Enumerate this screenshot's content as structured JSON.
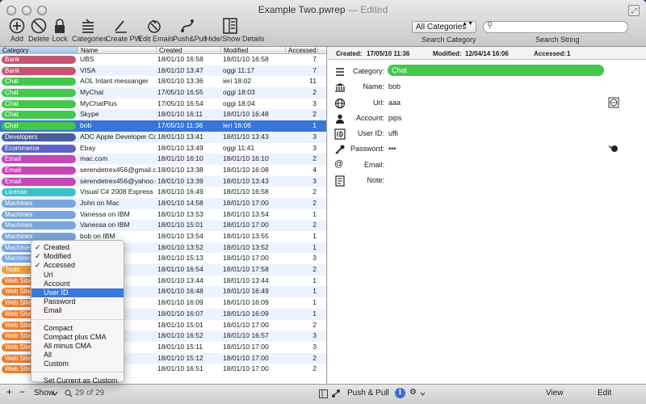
{
  "window": {
    "title": "Example Two.pwrep",
    "status": "— Edited",
    "fullscreen_glyph": "⤢"
  },
  "toolbar": {
    "items": [
      {
        "label": "Add",
        "icon": "add-icon"
      },
      {
        "label": "Delete",
        "icon": "delete-icon"
      },
      {
        "label": "Lock",
        "icon": "lock-icon"
      },
      {
        "label": "Categories",
        "icon": "categories-icon"
      },
      {
        "label": "Create PW",
        "icon": "create-pw-icon"
      },
      {
        "label": "Edit Emails",
        "icon": "edit-emails-icon"
      },
      {
        "label": "Push&Pull",
        "icon": "push-pull-icon"
      },
      {
        "label": "Hide/Show Details",
        "icon": "details-icon"
      }
    ],
    "category_select": "All Categories",
    "category_arrows": "▲▼",
    "search_category_label": "Search Category",
    "search_string_label": "Search String",
    "search_glyph": "⚲"
  },
  "table": {
    "headers": [
      "Category",
      "Name",
      "Created",
      "Modified",
      "Accessed"
    ],
    "rows": [
      {
        "cat": "Bank",
        "color": "#c4566f",
        "name": "UBS",
        "created": "18/01/10 16:58",
        "modified": "18/01/10 16:58",
        "accessed": "7"
      },
      {
        "cat": "Bank",
        "color": "#c4566f",
        "name": "VISA",
        "created": "18/01/10 13:47",
        "modified": "oggi 11:17",
        "accessed": "7"
      },
      {
        "cat": "Chat",
        "color": "#43c84c",
        "name": "AOL Intant messanger",
        "created": "18/01/10 13:36",
        "modified": "ieri 18:02",
        "accessed": "11"
      },
      {
        "cat": "Chat",
        "color": "#43c84c",
        "name": "MyChat",
        "created": "17/05/10 16:55",
        "modified": "oggi 18:03",
        "accessed": "2"
      },
      {
        "cat": "Chat",
        "color": "#43c84c",
        "name": "MyChatPlus",
        "created": "17/05/10 16:54",
        "modified": "oggi 18:04",
        "accessed": "3"
      },
      {
        "cat": "Chat",
        "color": "#43c84c",
        "name": "Skype",
        "created": "18/01/10 16:11",
        "modified": "18/01/10 16:48",
        "accessed": "2"
      },
      {
        "cat": "Chat",
        "color": "#43c84c",
        "name": "bob",
        "created": "17/05/10 11:36",
        "modified": "ieri 16:06",
        "accessed": "1",
        "selected": true
      },
      {
        "cat": "Developers",
        "color": "#4a5f9a",
        "name": "ADC Apple Developer Cor",
        "created": "18/01/10 13:41",
        "modified": "18/01/10 13:43",
        "accessed": "3"
      },
      {
        "cat": "Ecommerce",
        "color": "#5b63c7",
        "name": "Ebay",
        "created": "18/01/10 13:49",
        "modified": "oggi 11:41",
        "accessed": "3"
      },
      {
        "cat": "Email",
        "color": "#c547b8",
        "name": "mac.com",
        "created": "18/01/10 16:10",
        "modified": "18/01/10 16:10",
        "accessed": "2"
      },
      {
        "cat": "Email",
        "color": "#c547b8",
        "name": "serendetrex456@gmail.co",
        "created": "18/01/10 13:38",
        "modified": "18/01/10 16:08",
        "accessed": "4"
      },
      {
        "cat": "Email",
        "color": "#c547b8",
        "name": "serendetrex456@yahoo.c",
        "created": "18/01/10 13:39",
        "modified": "18/01/10 13:43",
        "accessed": "3"
      },
      {
        "cat": "License",
        "color": "#3bbfc9",
        "name": "Visual C# 2008 Express",
        "created": "18/01/10 16:49",
        "modified": "18/01/10 16:58",
        "accessed": "2"
      },
      {
        "cat": "Machines",
        "color": "#7aa6dc",
        "name": "John on Mac",
        "created": "18/01/10 14:58",
        "modified": "18/01/10 17:00",
        "accessed": "2"
      },
      {
        "cat": "Machines",
        "color": "#7aa6dc",
        "name": "Vanessa on IBM",
        "created": "18/01/10 13:53",
        "modified": "18/01/10 13:54",
        "accessed": "1"
      },
      {
        "cat": "Machines",
        "color": "#7aa6dc",
        "name": "Vanessa on IBM",
        "created": "18/01/10 15:01",
        "modified": "18/01/10 17:00",
        "accessed": "2"
      },
      {
        "cat": "Machines",
        "color": "#7aa6dc",
        "name": "bob on IBM",
        "created": "18/01/10 13:54",
        "modified": "18/01/10 13:55",
        "accessed": "1"
      },
      {
        "cat": "Machines",
        "color": "#7aa6dc",
        "name": "",
        "created": "18/01/10 13:52",
        "modified": "18/01/10 13:52",
        "accessed": "1"
      },
      {
        "cat": "Machines",
        "color": "#7aa6dc",
        "name": "",
        "created": "18/01/10 15:13",
        "modified": "18/01/10 17:00",
        "accessed": "3"
      },
      {
        "cat": "Tools",
        "color": "#e6a23c",
        "name": "",
        "created": "18/01/10 16:54",
        "modified": "18/01/10 17:58",
        "accessed": "2"
      },
      {
        "cat": "Web Sites",
        "color": "#ec7d2c",
        "name": "",
        "created": "18/01/10 13:44",
        "modified": "18/01/10 13:44",
        "accessed": "1"
      },
      {
        "cat": "Web Sites",
        "color": "#ec7d2c",
        "name": "",
        "created": "18/01/10 16:48",
        "modified": "18/01/10 16:49",
        "accessed": "1"
      },
      {
        "cat": "Web Sites",
        "color": "#ec7d2c",
        "name": "",
        "created": "18/01/10 16:09",
        "modified": "18/01/10 16:09",
        "accessed": "1"
      },
      {
        "cat": "Web Sites",
        "color": "#ec7d2c",
        "name": "",
        "created": "18/01/10 16:07",
        "modified": "18/01/10 16:09",
        "accessed": "1"
      },
      {
        "cat": "Web Sites",
        "color": "#ec7d2c",
        "name": "",
        "created": "18/01/10 15:01",
        "modified": "18/01/10 17:00",
        "accessed": "2"
      },
      {
        "cat": "Web Sites",
        "color": "#ec7d2c",
        "name": "",
        "created": "18/01/10 16:52",
        "modified": "18/01/10 16:57",
        "accessed": "3"
      },
      {
        "cat": "Web Sites",
        "color": "#ec7d2c",
        "name": "",
        "created": "18/01/10 15:11",
        "modified": "18/01/10 17:00",
        "accessed": "3"
      },
      {
        "cat": "Web Sites",
        "color": "#ec7d2c",
        "name": "",
        "created": "18/01/10 15:12",
        "modified": "18/01/10 17:00",
        "accessed": "2"
      },
      {
        "cat": "Web Sites",
        "color": "#ec7d2c",
        "name": "",
        "created": "18/01/10 16:51",
        "modified": "18/01/10 17:00",
        "accessed": "2"
      }
    ]
  },
  "bottombar": {
    "add": "+",
    "remove": "−",
    "show": "Show",
    "count": "29 of 29",
    "pushpull": "Push & Pull",
    "info": "i",
    "gear": "⚙",
    "view": "View",
    "edit": "Edit"
  },
  "detail": {
    "created_label": "Created:",
    "created": "17/05/10 11:36",
    "modified_label": "Modified:",
    "modified": "12/04/14 16:06",
    "accessed_label": "Accessed:",
    "accessed": "1",
    "fields": [
      {
        "label": "Category:",
        "value": "Chat",
        "icon": "category-icon"
      },
      {
        "label": "Name:",
        "value": "bob",
        "icon": "name-icon"
      },
      {
        "label": "Url:",
        "value": "aaa",
        "icon": "globe-icon"
      },
      {
        "label": "Account:",
        "value": "pips",
        "icon": "account-icon"
      },
      {
        "label": "User ID:",
        "value": "uffi",
        "icon": "userid-icon"
      },
      {
        "label": "Password:",
        "value": "•••",
        "icon": "key-icon"
      },
      {
        "label": "Email:",
        "value": "",
        "icon": "at-icon"
      },
      {
        "label": "Note:",
        "value": "",
        "icon": "note-icon"
      }
    ]
  },
  "menu": {
    "check": "✓",
    "items": [
      {
        "label": "Created",
        "checked": true
      },
      {
        "label": "Modified",
        "checked": true
      },
      {
        "label": "Accessed",
        "checked": true
      },
      {
        "label": "Url"
      },
      {
        "label": "Account"
      },
      {
        "label": "User ID",
        "highlighted": true
      },
      {
        "label": "Password"
      },
      {
        "label": "Email",
        "sep_after": true
      },
      {
        "label": "Compact"
      },
      {
        "label": "Compact plus CMA"
      },
      {
        "label": "All minus CMA"
      },
      {
        "label": "All"
      },
      {
        "label": "Custom",
        "sep_after": true
      },
      {
        "label": "Set Current as Custom"
      }
    ]
  }
}
